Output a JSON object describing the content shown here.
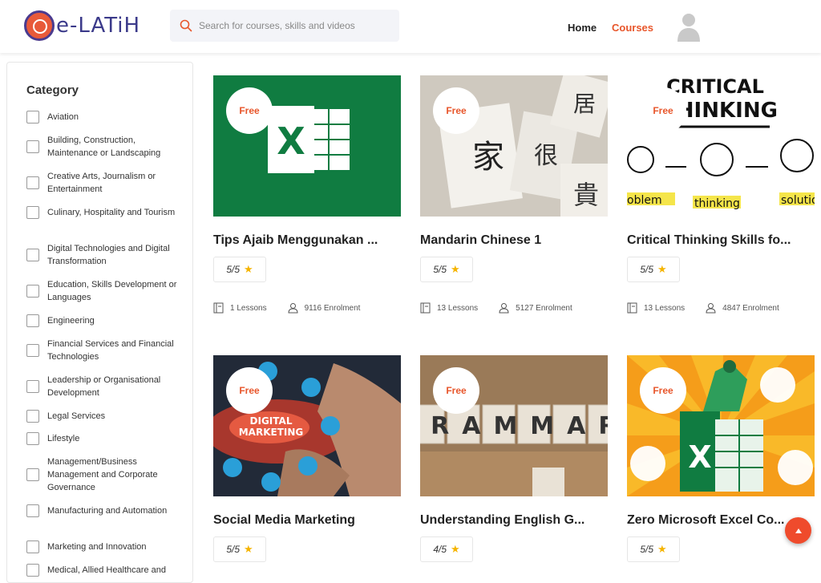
{
  "header": {
    "logo_text": "e-LATiH",
    "search_placeholder": "Search for courses, skills and videos",
    "nav_home": "Home",
    "nav_courses": "Courses"
  },
  "sidebar": {
    "title": "Category",
    "items": [
      {
        "label": "Aviation"
      },
      {
        "label": "Building, Construction, Maintenance or Landscaping"
      },
      {
        "label": "Creative Arts, Journalism or Entertainment"
      },
      {
        "label": "Culinary, Hospitality and Tourism"
      },
      {
        "label": "Digital Technologies and Digital Transformation"
      },
      {
        "label": "Education, Skills Development or Languages"
      },
      {
        "label": "Engineering"
      },
      {
        "label": "Financial Services and Financial Technologies"
      },
      {
        "label": "Leadership or Organisational Development"
      },
      {
        "label": "Legal Services"
      },
      {
        "label": "Lifestyle"
      },
      {
        "label": "Management/Business Management and Corporate Governance"
      },
      {
        "label": "Manufacturing and Automation"
      },
      {
        "label": "Marketing and Innovation"
      },
      {
        "label": "Medical, Allied Healthcare and"
      }
    ]
  },
  "courses": [
    {
      "badge": "Free",
      "title": "Tips Ajaib Menggunakan ...",
      "rating": "5/5",
      "lessons": "1 Lessons",
      "enrolment": "9116 Enrolment"
    },
    {
      "badge": "Free",
      "title": "Mandarin Chinese 1",
      "rating": "5/5",
      "lessons": "13 Lessons",
      "enrolment": "5127 Enrolment"
    },
    {
      "badge": "Free",
      "title": "Critical Thinking Skills fo...",
      "rating": "5/5",
      "lessons": "13 Lessons",
      "enrolment": "4847 Enrolment"
    },
    {
      "badge": "Free",
      "title": "Social Media Marketing",
      "rating": "5/5"
    },
    {
      "badge": "Free",
      "title": "Understanding English G...",
      "rating": "4/5"
    },
    {
      "badge": "Free",
      "title": "Zero Microsoft Excel Co...",
      "rating": "5/5"
    }
  ],
  "thumb_text": {
    "critical": "CRITICAL",
    "thinking": "THINKING",
    "problem": "oblem",
    "thinking_small": "thinking",
    "solution": "solutio",
    "digital": "DIGITAL",
    "marketing": "MARKETING",
    "grammar": "GRAMMAR",
    "hanzi_1": "家",
    "hanzi_2": "很",
    "hanzi_3": "居",
    "hanzi_4": "貴"
  },
  "colors": {
    "accent": "#e8562b",
    "brand": "#3b3a8a",
    "excel_green": "#107c41",
    "star": "#f5b400"
  }
}
